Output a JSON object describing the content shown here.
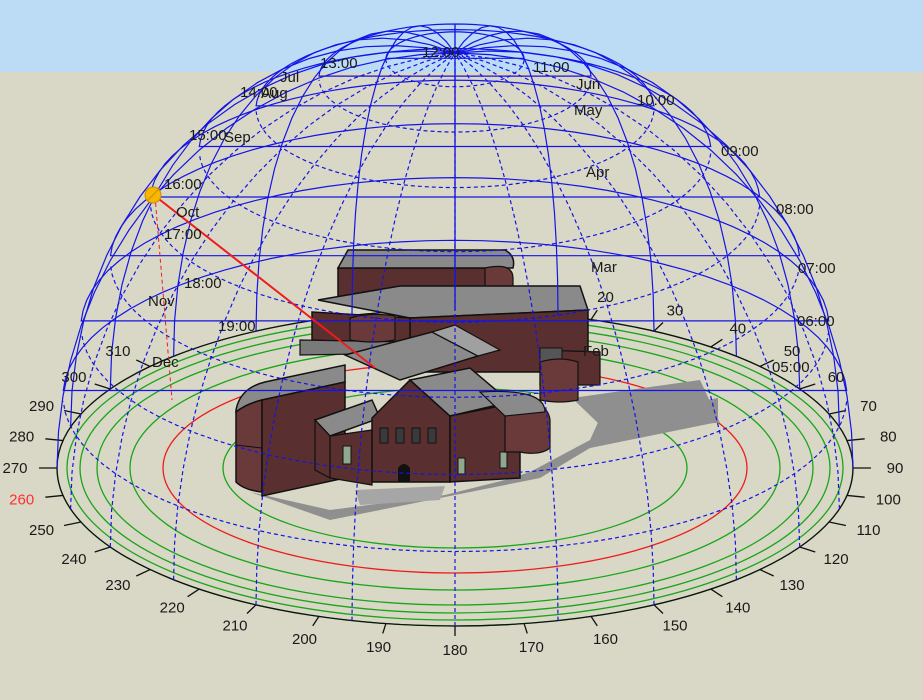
{
  "colors": {
    "sky": "#bcdcf6",
    "ground": "#d9d8c6",
    "dome_lines": "#1414e6",
    "ring_green": "#1aa51a",
    "ring_red": "#ee1c1c",
    "sun_ray": "#ee1c1c",
    "sun": "#f5b800",
    "label_text": "#1a1a1a",
    "highlight_text": "#ff3030",
    "brick": "#5a2f2f",
    "roof": "#8a8a8a",
    "shadow": "#8f8f8f"
  },
  "hour_labels": [
    "05:00",
    "06:00",
    "07:00",
    "08:00",
    "09:00",
    "10:00",
    "11:00",
    "12:00",
    "13:00",
    "14:00",
    "15:00",
    "16:00",
    "17:00",
    "18:00",
    "19:00"
  ],
  "month_labels": [
    "Feb",
    "Mar",
    "Apr",
    "May",
    "Jun",
    "Jul",
    "Aug",
    "Sep",
    "Oct",
    "Nov",
    "Dec"
  ],
  "azimuth_labels": [
    "20",
    "30",
    "40",
    "50",
    "60",
    "70",
    "80",
    "90",
    "100",
    "110",
    "120",
    "130",
    "140",
    "150",
    "160",
    "170",
    "180",
    "190",
    "200",
    "210",
    "220",
    "230",
    "240",
    "250",
    "260",
    "270",
    "280",
    "290",
    "300",
    "310"
  ],
  "highlighted_azimuth": "260",
  "sun_icon": "sun-icon"
}
